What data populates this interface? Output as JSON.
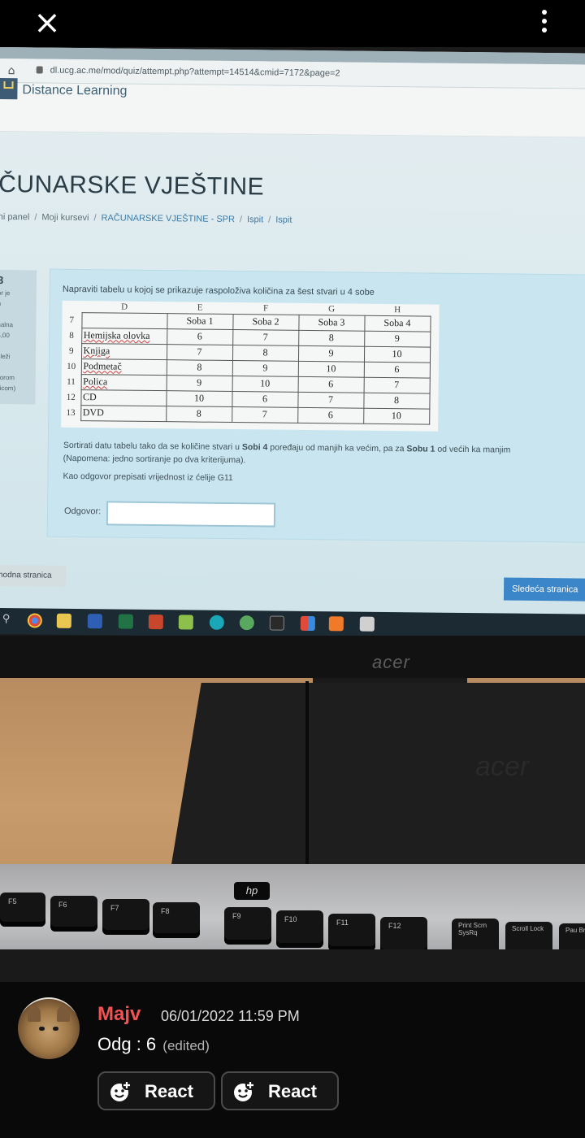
{
  "viewer": {
    "close_glyph": "×"
  },
  "browser": {
    "url": "dl.ucg.ac.me/mod/quiz/attempt.php?attempt=14514&cmid=7172&page=2"
  },
  "site": {
    "name": "Distance Learning",
    "course_title": "ČUNARSKE VJEŠTINE",
    "breadcrumb": [
      "ni panel",
      "Moji kursevi",
      "RAČUNARSKE VJEŠTINE - SPR",
      "Ispit",
      "Ispit"
    ]
  },
  "question_info": {
    "number": "3",
    "lines": [
      "or je",
      "n",
      "",
      "nalna",
      "5,00",
      "",
      "eleži",
      "",
      "zorom",
      "vicom)"
    ]
  },
  "question": {
    "prompt": "Napraviti tabelu u kojoj se prikazuje raspoloživa količina za šest stvari u 4 sobe",
    "column_letters": [
      "D",
      "E",
      "F",
      "G",
      "H"
    ],
    "header_row": {
      "num": "7",
      "cells": [
        "",
        "Soba 1",
        "Soba 2",
        "Soba 3",
        "Soba 4"
      ]
    },
    "rows": [
      {
        "num": "8",
        "item": "Hemijska olovka",
        "values": [
          "6",
          "7",
          "8",
          "9"
        ]
      },
      {
        "num": "9",
        "item": "Knjiga",
        "values": [
          "7",
          "8",
          "9",
          "10"
        ]
      },
      {
        "num": "10",
        "item": "Podmetač",
        "values": [
          "8",
          "9",
          "10",
          "6"
        ]
      },
      {
        "num": "11",
        "item": "Polica",
        "values": [
          "9",
          "10",
          "6",
          "7"
        ]
      },
      {
        "num": "12",
        "item": "CD",
        "values": [
          "10",
          "6",
          "7",
          "8"
        ]
      },
      {
        "num": "13",
        "item": "DVD",
        "values": [
          "8",
          "7",
          "6",
          "10"
        ]
      }
    ],
    "sort_text_1": "Sortirati datu tabelu tako da se količine stvari u ",
    "sort_bold_1": "Sobi 4",
    "sort_text_2": " poređaju od manjih ka većim, pa za ",
    "sort_bold_2": "Sobu 1",
    "sort_text_3": " od većih ka manjim",
    "note": "(Napomena: jedno sortiranje po dva kriterijuma).",
    "answer_hint": "Kao odgovor prepisati vrijednost iz ćelije G11",
    "answer_label": "Odgovor:",
    "answer_value": ""
  },
  "navigation": {
    "prev_label": "thodna stranica",
    "next_label": "Sledeća stranica"
  },
  "monitor": {
    "brand": "acer",
    "base_brand": "acer"
  },
  "keyboard": {
    "brand": "hp",
    "keys": [
      "F5",
      "F6",
      "F7",
      "F8",
      "F9",
      "F10",
      "F11",
      "F12",
      "Print Scrn SysRq",
      "Scroll Lock",
      "Pau Bre"
    ]
  },
  "chat": {
    "username": "Majv",
    "timestamp": "06/01/2022 11:59 PM",
    "message": "Odg : 6",
    "edited_tag": "(edited)",
    "react_label_1": "React",
    "react_label_2": "React",
    "username_color": "#f25252"
  }
}
